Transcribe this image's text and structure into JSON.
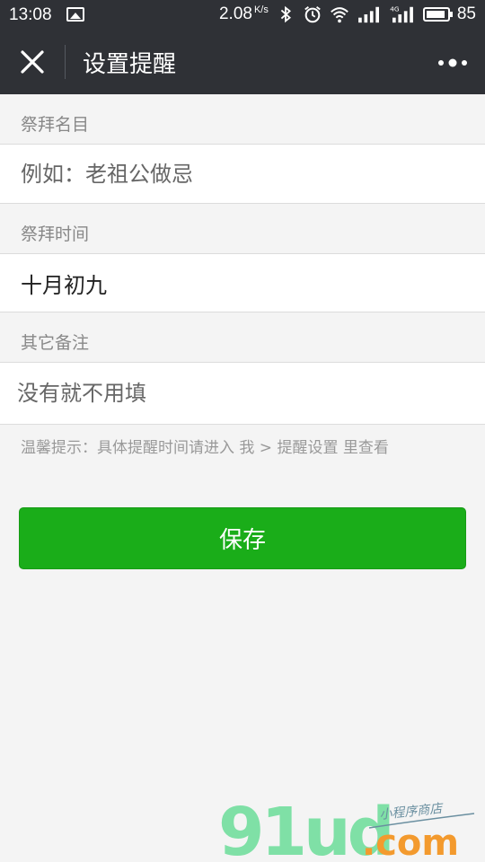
{
  "status_bar": {
    "time": "13:08",
    "speed": "2.08",
    "speed_unit": "K/s",
    "battery": "85",
    "icons": [
      "image-notification-icon",
      "bluetooth-icon",
      "alarm-icon",
      "wifi-icon",
      "signal-icon",
      "4g-signal-icon",
      "battery-icon"
    ]
  },
  "nav": {
    "title": "设置提醒",
    "close_icon": "close-icon",
    "more_icon": "more-dots-icon"
  },
  "form": {
    "name_label": "祭拜名目",
    "name_placeholder": "例如：老祖公做忌",
    "name_value": "",
    "time_label": "祭拜时间",
    "time_value": "十月初九",
    "note_label": "其它备注",
    "note_placeholder": "没有就不用填",
    "note_value": ""
  },
  "tip": "温馨提示：具体提醒时间请进入 我 > 提醒设置 里查看",
  "save_label": "保存",
  "watermark": {
    "brand": "91ud",
    "domain": ".com",
    "tagline": "小程序商店"
  },
  "colors": {
    "nav_bg": "#2f3136",
    "page_bg": "#f4f4f4",
    "primary_green": "#1aad19",
    "watermark_green": "#7fe0a6",
    "watermark_orange": "#f39a2e"
  }
}
